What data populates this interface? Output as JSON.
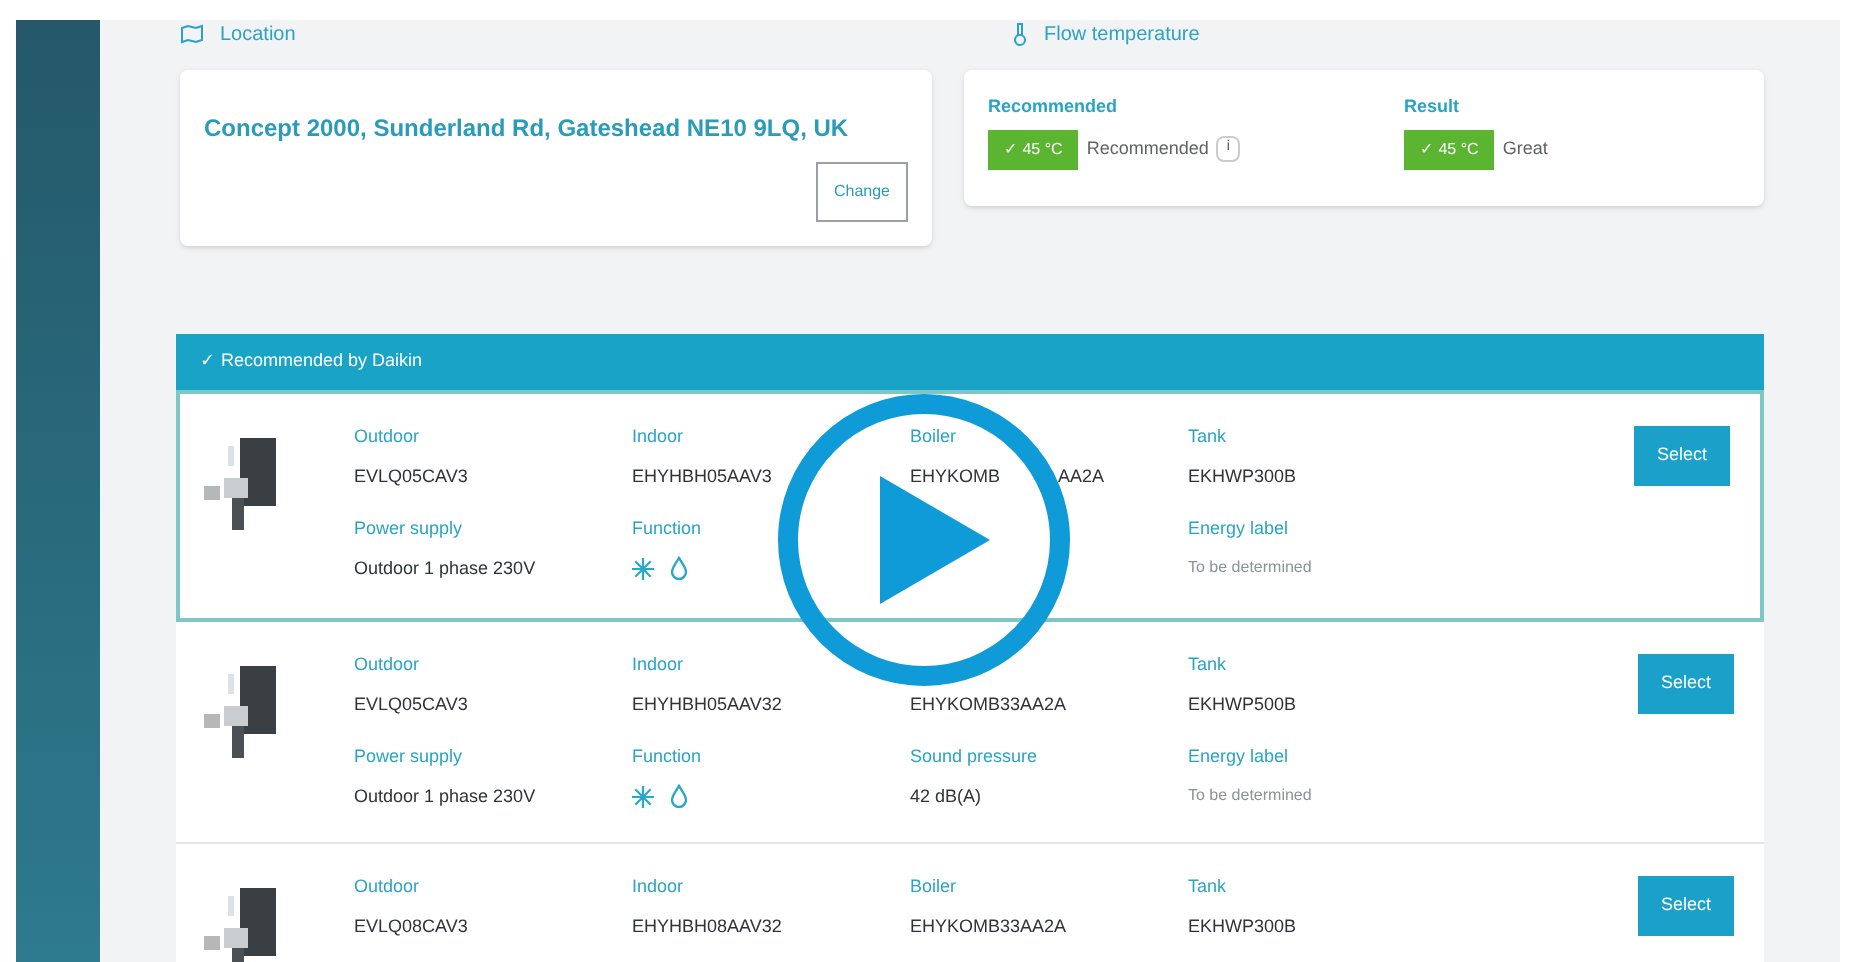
{
  "location": {
    "heading": "Location",
    "address": "Concept 2000, Sunderland Rd, Gateshead NE10 9LQ, UK",
    "button": "Change"
  },
  "flow_temperature": {
    "heading": "Flow temperature",
    "items": [
      {
        "label": "Recommended",
        "value": "✓ 45 °C",
        "note": "Recommended",
        "info": "i"
      },
      {
        "label": "Result",
        "value": "✓ 45 °C",
        "note": "Great"
      }
    ]
  },
  "recommended_header": "✓ Recommended by Daikin",
  "systems": [
    {
      "selected": true,
      "fields": [
        {
          "label": "Outdoor",
          "value": "EVLQ05CAV3"
        },
        {
          "label": "Indoor",
          "value": "EHYHBH05AAV3"
        },
        {
          "label": "Boiler",
          "value": "EHYKOMB",
          "value_end": "AA2A"
        },
        {
          "label": "Tank",
          "value": "EKHWP300B"
        },
        {
          "label": "Power supply",
          "value": "Outdoor 1 phase 230V"
        },
        {
          "label": "Function",
          "kind": "icons"
        },
        {
          "label": "Energy label",
          "value": "To be determined",
          "kind": "note"
        }
      ],
      "button": "Select"
    },
    {
      "selected": false,
      "fields": [
        {
          "label": "Outdoor",
          "value": "EVLQ05CAV3"
        },
        {
          "label": "Indoor",
          "value": "EHYHBH05AAV32"
        },
        {
          "value": "EHYKOMB33AA2A"
        },
        {
          "label": "Tank",
          "value": "EKHWP500B"
        },
        {
          "label": "Power supply",
          "value": "Outdoor 1 phase 230V"
        },
        {
          "label": "Function",
          "kind": "icons"
        },
        {
          "label": "Sound pressure",
          "value": "42 dB(A)"
        },
        {
          "label": "Energy label",
          "value": "To be determined",
          "kind": "note"
        }
      ],
      "button": "Select"
    },
    {
      "selected": false,
      "fields": [
        {
          "label": "Outdoor",
          "value": "EVLQ08CAV3"
        },
        {
          "label": "Indoor",
          "value": "EHYHBH08AAV32"
        },
        {
          "label": "Boiler",
          "value": "EHYKOMB33AA2A"
        },
        {
          "label": "Tank",
          "value": "EKHWP300B"
        }
      ],
      "button": "Select"
    }
  ]
}
